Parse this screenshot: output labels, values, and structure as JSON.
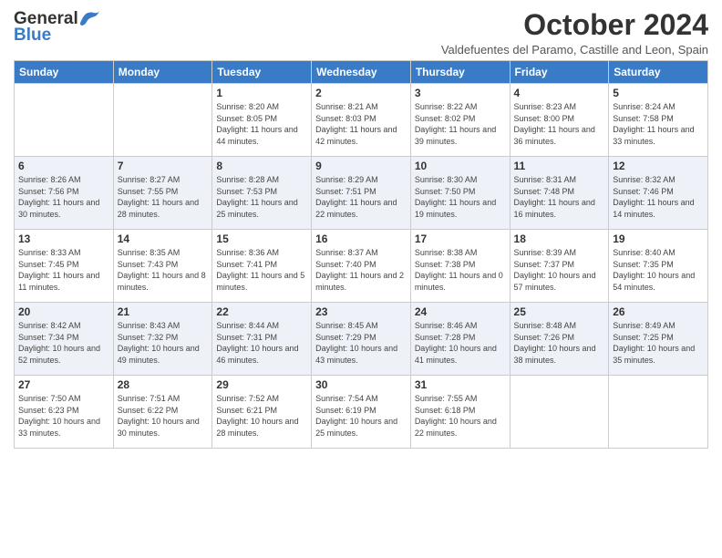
{
  "header": {
    "logo_general": "General",
    "logo_blue": "Blue",
    "month_title": "October 2024",
    "location": "Valdefuentes del Paramo, Castille and Leon, Spain"
  },
  "days_of_week": [
    "Sunday",
    "Monday",
    "Tuesday",
    "Wednesday",
    "Thursday",
    "Friday",
    "Saturday"
  ],
  "weeks": [
    [
      {
        "day": "",
        "sunrise": "",
        "sunset": "",
        "daylight": ""
      },
      {
        "day": "",
        "sunrise": "",
        "sunset": "",
        "daylight": ""
      },
      {
        "day": "1",
        "sunrise": "Sunrise: 8:20 AM",
        "sunset": "Sunset: 8:05 PM",
        "daylight": "Daylight: 11 hours and 44 minutes."
      },
      {
        "day": "2",
        "sunrise": "Sunrise: 8:21 AM",
        "sunset": "Sunset: 8:03 PM",
        "daylight": "Daylight: 11 hours and 42 minutes."
      },
      {
        "day": "3",
        "sunrise": "Sunrise: 8:22 AM",
        "sunset": "Sunset: 8:02 PM",
        "daylight": "Daylight: 11 hours and 39 minutes."
      },
      {
        "day": "4",
        "sunrise": "Sunrise: 8:23 AM",
        "sunset": "Sunset: 8:00 PM",
        "daylight": "Daylight: 11 hours and 36 minutes."
      },
      {
        "day": "5",
        "sunrise": "Sunrise: 8:24 AM",
        "sunset": "Sunset: 7:58 PM",
        "daylight": "Daylight: 11 hours and 33 minutes."
      }
    ],
    [
      {
        "day": "6",
        "sunrise": "Sunrise: 8:26 AM",
        "sunset": "Sunset: 7:56 PM",
        "daylight": "Daylight: 11 hours and 30 minutes."
      },
      {
        "day": "7",
        "sunrise": "Sunrise: 8:27 AM",
        "sunset": "Sunset: 7:55 PM",
        "daylight": "Daylight: 11 hours and 28 minutes."
      },
      {
        "day": "8",
        "sunrise": "Sunrise: 8:28 AM",
        "sunset": "Sunset: 7:53 PM",
        "daylight": "Daylight: 11 hours and 25 minutes."
      },
      {
        "day": "9",
        "sunrise": "Sunrise: 8:29 AM",
        "sunset": "Sunset: 7:51 PM",
        "daylight": "Daylight: 11 hours and 22 minutes."
      },
      {
        "day": "10",
        "sunrise": "Sunrise: 8:30 AM",
        "sunset": "Sunset: 7:50 PM",
        "daylight": "Daylight: 11 hours and 19 minutes."
      },
      {
        "day": "11",
        "sunrise": "Sunrise: 8:31 AM",
        "sunset": "Sunset: 7:48 PM",
        "daylight": "Daylight: 11 hours and 16 minutes."
      },
      {
        "day": "12",
        "sunrise": "Sunrise: 8:32 AM",
        "sunset": "Sunset: 7:46 PM",
        "daylight": "Daylight: 11 hours and 14 minutes."
      }
    ],
    [
      {
        "day": "13",
        "sunrise": "Sunrise: 8:33 AM",
        "sunset": "Sunset: 7:45 PM",
        "daylight": "Daylight: 11 hours and 11 minutes."
      },
      {
        "day": "14",
        "sunrise": "Sunrise: 8:35 AM",
        "sunset": "Sunset: 7:43 PM",
        "daylight": "Daylight: 11 hours and 8 minutes."
      },
      {
        "day": "15",
        "sunrise": "Sunrise: 8:36 AM",
        "sunset": "Sunset: 7:41 PM",
        "daylight": "Daylight: 11 hours and 5 minutes."
      },
      {
        "day": "16",
        "sunrise": "Sunrise: 8:37 AM",
        "sunset": "Sunset: 7:40 PM",
        "daylight": "Daylight: 11 hours and 2 minutes."
      },
      {
        "day": "17",
        "sunrise": "Sunrise: 8:38 AM",
        "sunset": "Sunset: 7:38 PM",
        "daylight": "Daylight: 11 hours and 0 minutes."
      },
      {
        "day": "18",
        "sunrise": "Sunrise: 8:39 AM",
        "sunset": "Sunset: 7:37 PM",
        "daylight": "Daylight: 10 hours and 57 minutes."
      },
      {
        "day": "19",
        "sunrise": "Sunrise: 8:40 AM",
        "sunset": "Sunset: 7:35 PM",
        "daylight": "Daylight: 10 hours and 54 minutes."
      }
    ],
    [
      {
        "day": "20",
        "sunrise": "Sunrise: 8:42 AM",
        "sunset": "Sunset: 7:34 PM",
        "daylight": "Daylight: 10 hours and 52 minutes."
      },
      {
        "day": "21",
        "sunrise": "Sunrise: 8:43 AM",
        "sunset": "Sunset: 7:32 PM",
        "daylight": "Daylight: 10 hours and 49 minutes."
      },
      {
        "day": "22",
        "sunrise": "Sunrise: 8:44 AM",
        "sunset": "Sunset: 7:31 PM",
        "daylight": "Daylight: 10 hours and 46 minutes."
      },
      {
        "day": "23",
        "sunrise": "Sunrise: 8:45 AM",
        "sunset": "Sunset: 7:29 PM",
        "daylight": "Daylight: 10 hours and 43 minutes."
      },
      {
        "day": "24",
        "sunrise": "Sunrise: 8:46 AM",
        "sunset": "Sunset: 7:28 PM",
        "daylight": "Daylight: 10 hours and 41 minutes."
      },
      {
        "day": "25",
        "sunrise": "Sunrise: 8:48 AM",
        "sunset": "Sunset: 7:26 PM",
        "daylight": "Daylight: 10 hours and 38 minutes."
      },
      {
        "day": "26",
        "sunrise": "Sunrise: 8:49 AM",
        "sunset": "Sunset: 7:25 PM",
        "daylight": "Daylight: 10 hours and 35 minutes."
      }
    ],
    [
      {
        "day": "27",
        "sunrise": "Sunrise: 7:50 AM",
        "sunset": "Sunset: 6:23 PM",
        "daylight": "Daylight: 10 hours and 33 minutes."
      },
      {
        "day": "28",
        "sunrise": "Sunrise: 7:51 AM",
        "sunset": "Sunset: 6:22 PM",
        "daylight": "Daylight: 10 hours and 30 minutes."
      },
      {
        "day": "29",
        "sunrise": "Sunrise: 7:52 AM",
        "sunset": "Sunset: 6:21 PM",
        "daylight": "Daylight: 10 hours and 28 minutes."
      },
      {
        "day": "30",
        "sunrise": "Sunrise: 7:54 AM",
        "sunset": "Sunset: 6:19 PM",
        "daylight": "Daylight: 10 hours and 25 minutes."
      },
      {
        "day": "31",
        "sunrise": "Sunrise: 7:55 AM",
        "sunset": "Sunset: 6:18 PM",
        "daylight": "Daylight: 10 hours and 22 minutes."
      },
      {
        "day": "",
        "sunrise": "",
        "sunset": "",
        "daylight": ""
      },
      {
        "day": "",
        "sunrise": "",
        "sunset": "",
        "daylight": ""
      }
    ]
  ]
}
